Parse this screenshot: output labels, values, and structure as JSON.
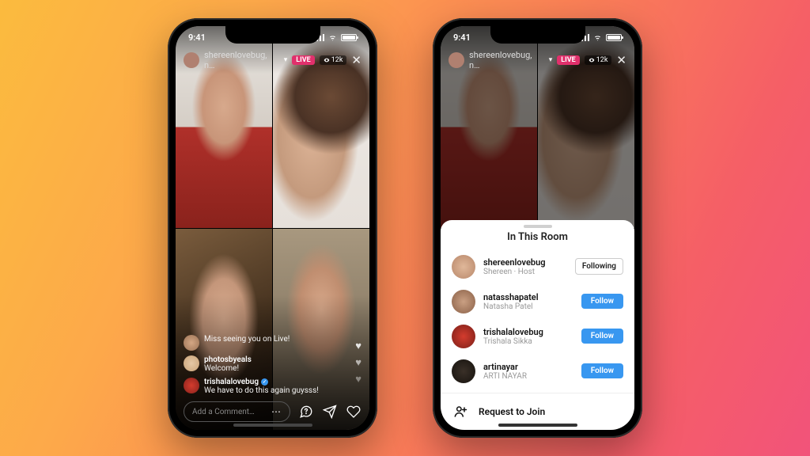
{
  "status": {
    "time": "9:41"
  },
  "header": {
    "host_username": "shereenlovebug, n…",
    "live_label": "LIVE",
    "viewer_count": "12k"
  },
  "comments": [
    {
      "username": "",
      "text": "Miss seeing you on Live!"
    },
    {
      "username": "photosbyeals",
      "text": "Welcome!"
    },
    {
      "username": "trishalalovebug",
      "text": "We have to do this again guysss!"
    }
  ],
  "comment_input": {
    "placeholder": "Add a Comment…"
  },
  "sheet": {
    "title": "In This Room",
    "participants": [
      {
        "username": "shereenlovebug",
        "display_name": "Shereen · Host",
        "action": "Following"
      },
      {
        "username": "natasshapatel",
        "display_name": "Natasha Patel",
        "action": "Follow"
      },
      {
        "username": "trishalalovebug",
        "display_name": "Trishala Sikka",
        "action": "Follow"
      },
      {
        "username": "artinayar",
        "display_name": "ARTI NAYAR",
        "action": "Follow"
      }
    ],
    "request_label": "Request to Join"
  }
}
